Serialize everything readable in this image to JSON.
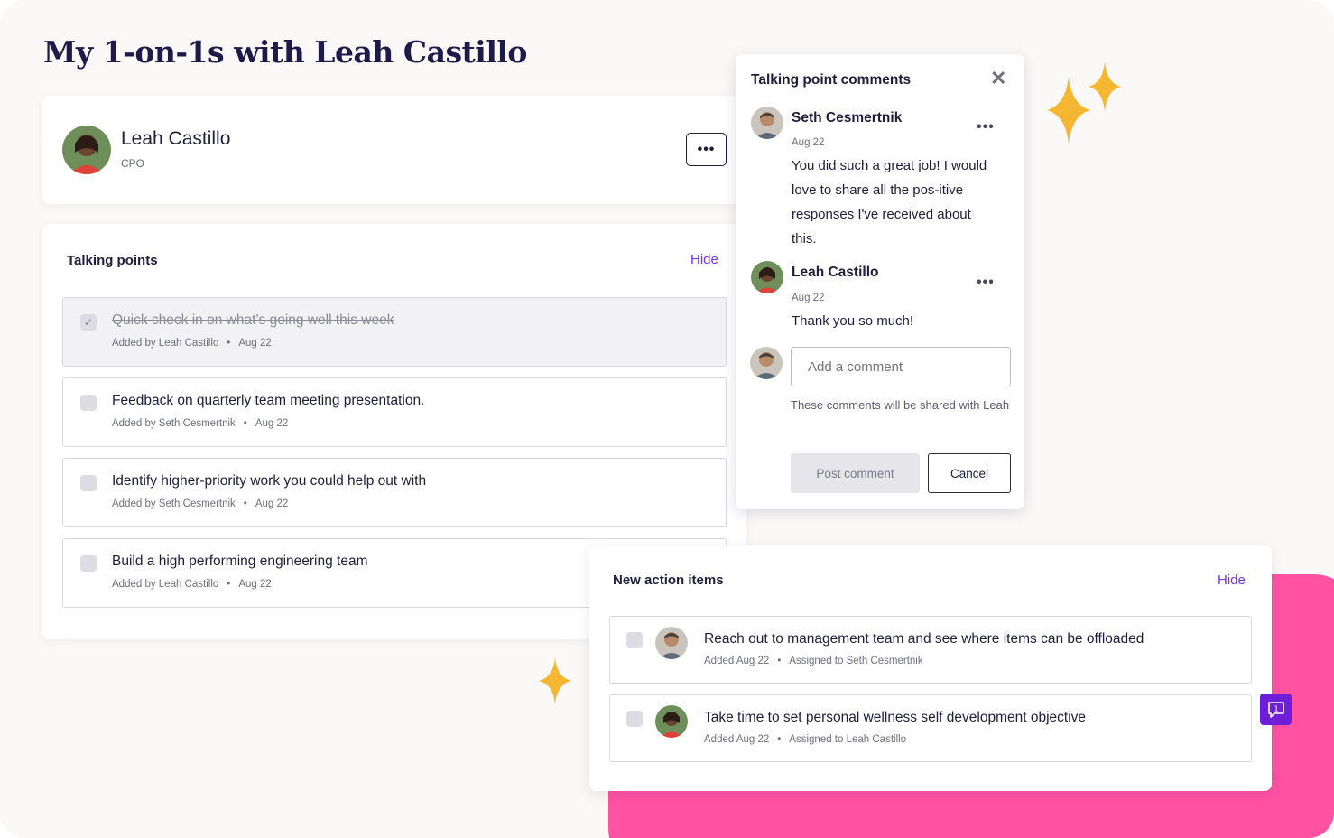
{
  "page": {
    "title": "My 1-on-1s with Leah Castillo"
  },
  "profile": {
    "name": "Leah Castillo",
    "role": "CPO",
    "more_label": "•••"
  },
  "talking_points": {
    "title": "Talking points",
    "hide_label": "Hide",
    "items": [
      {
        "text": "Quick check in on what’s going well this week",
        "added_by": "Added by Leah Castillo",
        "sep": "•",
        "date": "Aug 22",
        "done": true
      },
      {
        "text": "Feedback on quarterly team meeting presentation.",
        "added_by": "Added by Seth Cesmertnik",
        "sep": "•",
        "date": "Aug 22",
        "done": false
      },
      {
        "text": "Identify higher-priority work you could help out with",
        "added_by": "Added by Seth Cesmertnik",
        "sep": "•",
        "date": "Aug 22",
        "done": false
      },
      {
        "text": "Build a high performing engineering team",
        "added_by": "Added by Leah Castillo",
        "sep": "•",
        "date": "Aug 22",
        "done": false
      }
    ]
  },
  "comments": {
    "title": "Talking point comments",
    "close_label": "✕",
    "items": [
      {
        "name": "Seth Cesmertnik",
        "date": "Aug 22",
        "body": "You did such a great job! I would love to share all the pos-itive responses I've received about this.",
        "menu": "•••"
      },
      {
        "name": "Leah Castillo",
        "date": "Aug 22",
        "body": "Thank you so much!",
        "menu": "•••"
      }
    ],
    "input_placeholder": "Add a comment",
    "share_note": "These comments will be shared with Leah",
    "post_label": "Post comment",
    "cancel_label": "Cancel"
  },
  "action_items": {
    "title": "New action items",
    "hide_label": "Hide",
    "items": [
      {
        "text": "Reach out to management team and see where items can be offloaded",
        "added": "Added Aug 22",
        "sep": "•",
        "assigned": "Assigned to Seth Cesmertnik"
      },
      {
        "text": "Take time to set personal wellness self development objective",
        "added": "Added Aug 22",
        "sep": "•",
        "assigned": "Assigned to Leah Castillo"
      }
    ]
  },
  "chat_badge": {
    "count": "1"
  },
  "colors": {
    "accent": "#7a32e8",
    "pink": "#ff52a2",
    "sparkle": "#f5b731",
    "chat": "#6d1fd8"
  },
  "icons": [
    "checkmark-icon",
    "close-icon",
    "more-icon",
    "chat-icon",
    "sparkle-icon"
  ]
}
